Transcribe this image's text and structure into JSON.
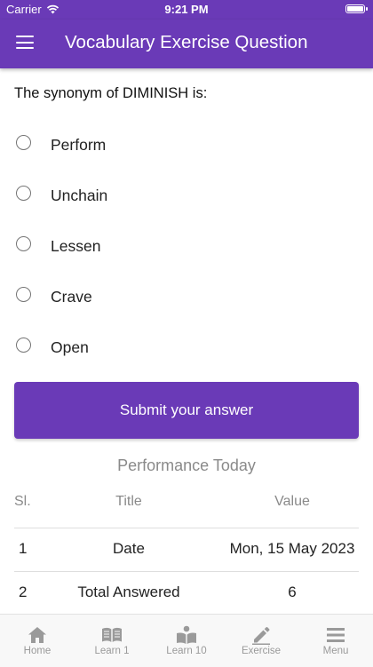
{
  "status_bar": {
    "carrier": "Carrier",
    "time": "9:21 PM"
  },
  "app_bar": {
    "title": "Vocabulary Exercise Question"
  },
  "question": {
    "text": "The synonym of DIMINISH is:",
    "options": [
      "Perform",
      "Unchain",
      "Lessen",
      "Crave",
      "Open"
    ]
  },
  "submit_label": "Submit your answer",
  "performance": {
    "title": "Performance Today",
    "headers": [
      "Sl.",
      "Title",
      "Value"
    ],
    "rows": [
      [
        "1",
        "Date",
        "Mon, 15 May 2023"
      ],
      [
        "2",
        "Total Answered",
        "6"
      ]
    ]
  },
  "tabs": [
    {
      "label": "Home",
      "icon": "home-icon"
    },
    {
      "label": "Learn 1",
      "icon": "open-book-icon"
    },
    {
      "label": "Learn 10",
      "icon": "reader-icon"
    },
    {
      "label": "Exercise",
      "icon": "pencil-icon"
    },
    {
      "label": "Menu",
      "icon": "hamburger-icon"
    }
  ],
  "colors": {
    "primary": "#6a3ab7",
    "muted": "#8a8a8a",
    "tab_inactive": "#9a9a9a"
  }
}
